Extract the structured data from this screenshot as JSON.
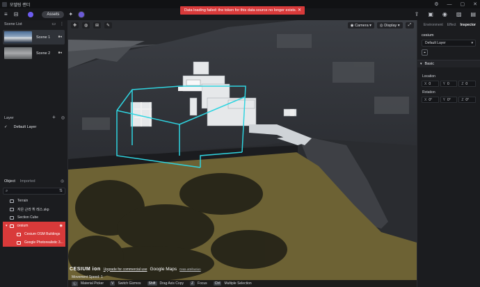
{
  "window": {
    "title": "모델링 랜더",
    "controls": [
      "⚙",
      "—",
      "▢",
      "✕"
    ]
  },
  "toolbar": {
    "menu_icon": "≡",
    "layout_icon": "⊟",
    "assets_label": "Assets",
    "right_icons": [
      "export-icon",
      "save-icon",
      "camera-icon",
      "image-icon",
      "film-icon"
    ]
  },
  "toast": {
    "message": "Data loading failed: the token for this data source no longer exists.",
    "close": "✕"
  },
  "scene_list": {
    "title": "Scene List",
    "scenes": [
      {
        "label": "Scene 1",
        "active": true
      },
      {
        "label": "Scene 2",
        "active": false
      }
    ]
  },
  "layer": {
    "title": "Layer",
    "add": "+",
    "items": [
      {
        "label": "Default Layer",
        "checked": "✓"
      }
    ]
  },
  "object": {
    "tabs": [
      "Object",
      "Imported"
    ],
    "search_placeholder": "",
    "items": [
      {
        "label": "Terrain"
      },
      {
        "label": "자은 근라 뷔 레스.skp"
      },
      {
        "label": "Section Cube"
      }
    ],
    "group": {
      "label": "cesium",
      "children": [
        "Cesium OSM Buildings",
        "Google Photorealistic 3..."
      ]
    }
  },
  "viewport": {
    "camera_label": "Camera",
    "display_label": "Display",
    "credit_upgrade": "Upgrade for commercial use",
    "credit_cesium": "CESIUM ion",
    "credit_google": "Google Maps",
    "credit_data": "Data attribution",
    "movement_speed": "Movement Speed: 1",
    "shortcuts": [
      {
        "key": "Ⓛ",
        "label": "Material Picker"
      },
      {
        "key": "V",
        "label": "Switch Gizmos"
      },
      {
        "key": "Shift",
        "label": "Drag Axis Copy"
      },
      {
        "key": "Z",
        "label": "Focus"
      },
      {
        "key": "Ctrl",
        "label": "Multiple Selection"
      }
    ]
  },
  "inspector": {
    "tabs": [
      "Environment",
      "Effect",
      "Inspector"
    ],
    "object_name": "cesium",
    "layer_select": "Default Layer",
    "section": "Basic",
    "location_label": "Location",
    "location": {
      "x": "0",
      "y": "0",
      "z": "0"
    },
    "rotation_label": "Rotation",
    "rotation": {
      "x": "0°",
      "y": "0°",
      "z": "0°"
    }
  },
  "colors": {
    "accent_red": "#d93a3a",
    "accent_purple": "#6d5cf0",
    "panel_bg": "#1b1c1f"
  }
}
